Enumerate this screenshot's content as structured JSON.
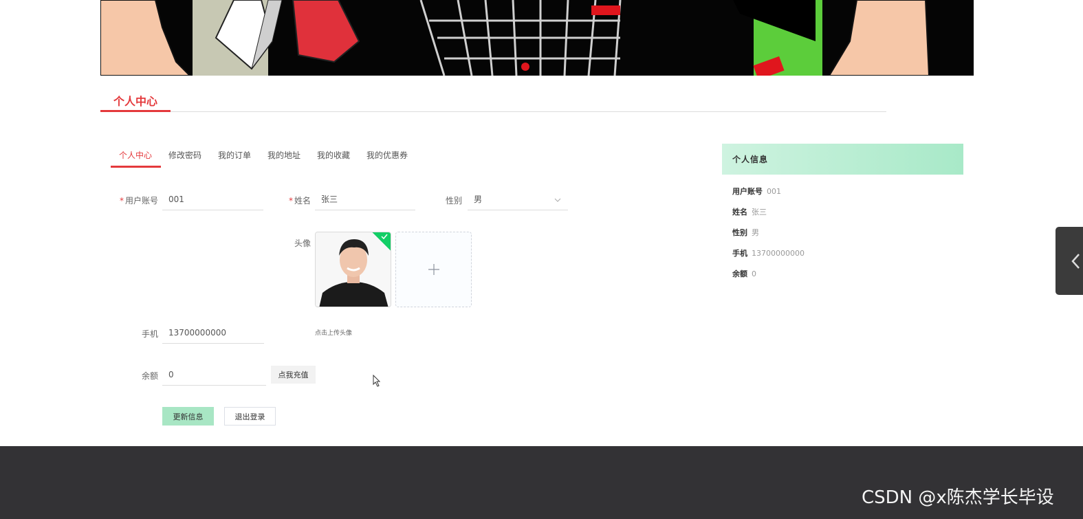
{
  "section": {
    "title": "个人中心"
  },
  "tabs": [
    {
      "label": "个人中心"
    },
    {
      "label": "修改密码"
    },
    {
      "label": "我的订单"
    },
    {
      "label": "我的地址"
    },
    {
      "label": "我的收藏"
    },
    {
      "label": "我的优惠券"
    }
  ],
  "form": {
    "required_mark": "*",
    "account_label": "用户账号",
    "account_value": "001",
    "name_label": "姓名",
    "name_value": "张三",
    "gender_label": "性别",
    "gender_value": "男",
    "avatar_label": "头像",
    "upload_tip": "点击上传头像",
    "phone_label": "手机",
    "phone_value": "13700000000",
    "balance_label": "余额",
    "balance_value": "0",
    "recharge_button": "点我充值",
    "update_button": "更新信息",
    "logout_button": "退出登录"
  },
  "panel": {
    "title": "个人信息",
    "rows": [
      {
        "key": "用户账号",
        "value": "001"
      },
      {
        "key": "姓名",
        "value": "张三"
      },
      {
        "key": "性别",
        "value": "男"
      },
      {
        "key": "手机",
        "value": "13700000000"
      },
      {
        "key": "余额",
        "value": "0"
      }
    ]
  },
  "watermark": "CSDN @x陈杰学长毕设",
  "colors": {
    "accent": "#e4393c",
    "success": "#13ce66",
    "footer": "#333235"
  },
  "icons": {
    "upload": "plus-icon",
    "select": "chevron-down-icon",
    "toggle": "chevron-left-icon"
  }
}
